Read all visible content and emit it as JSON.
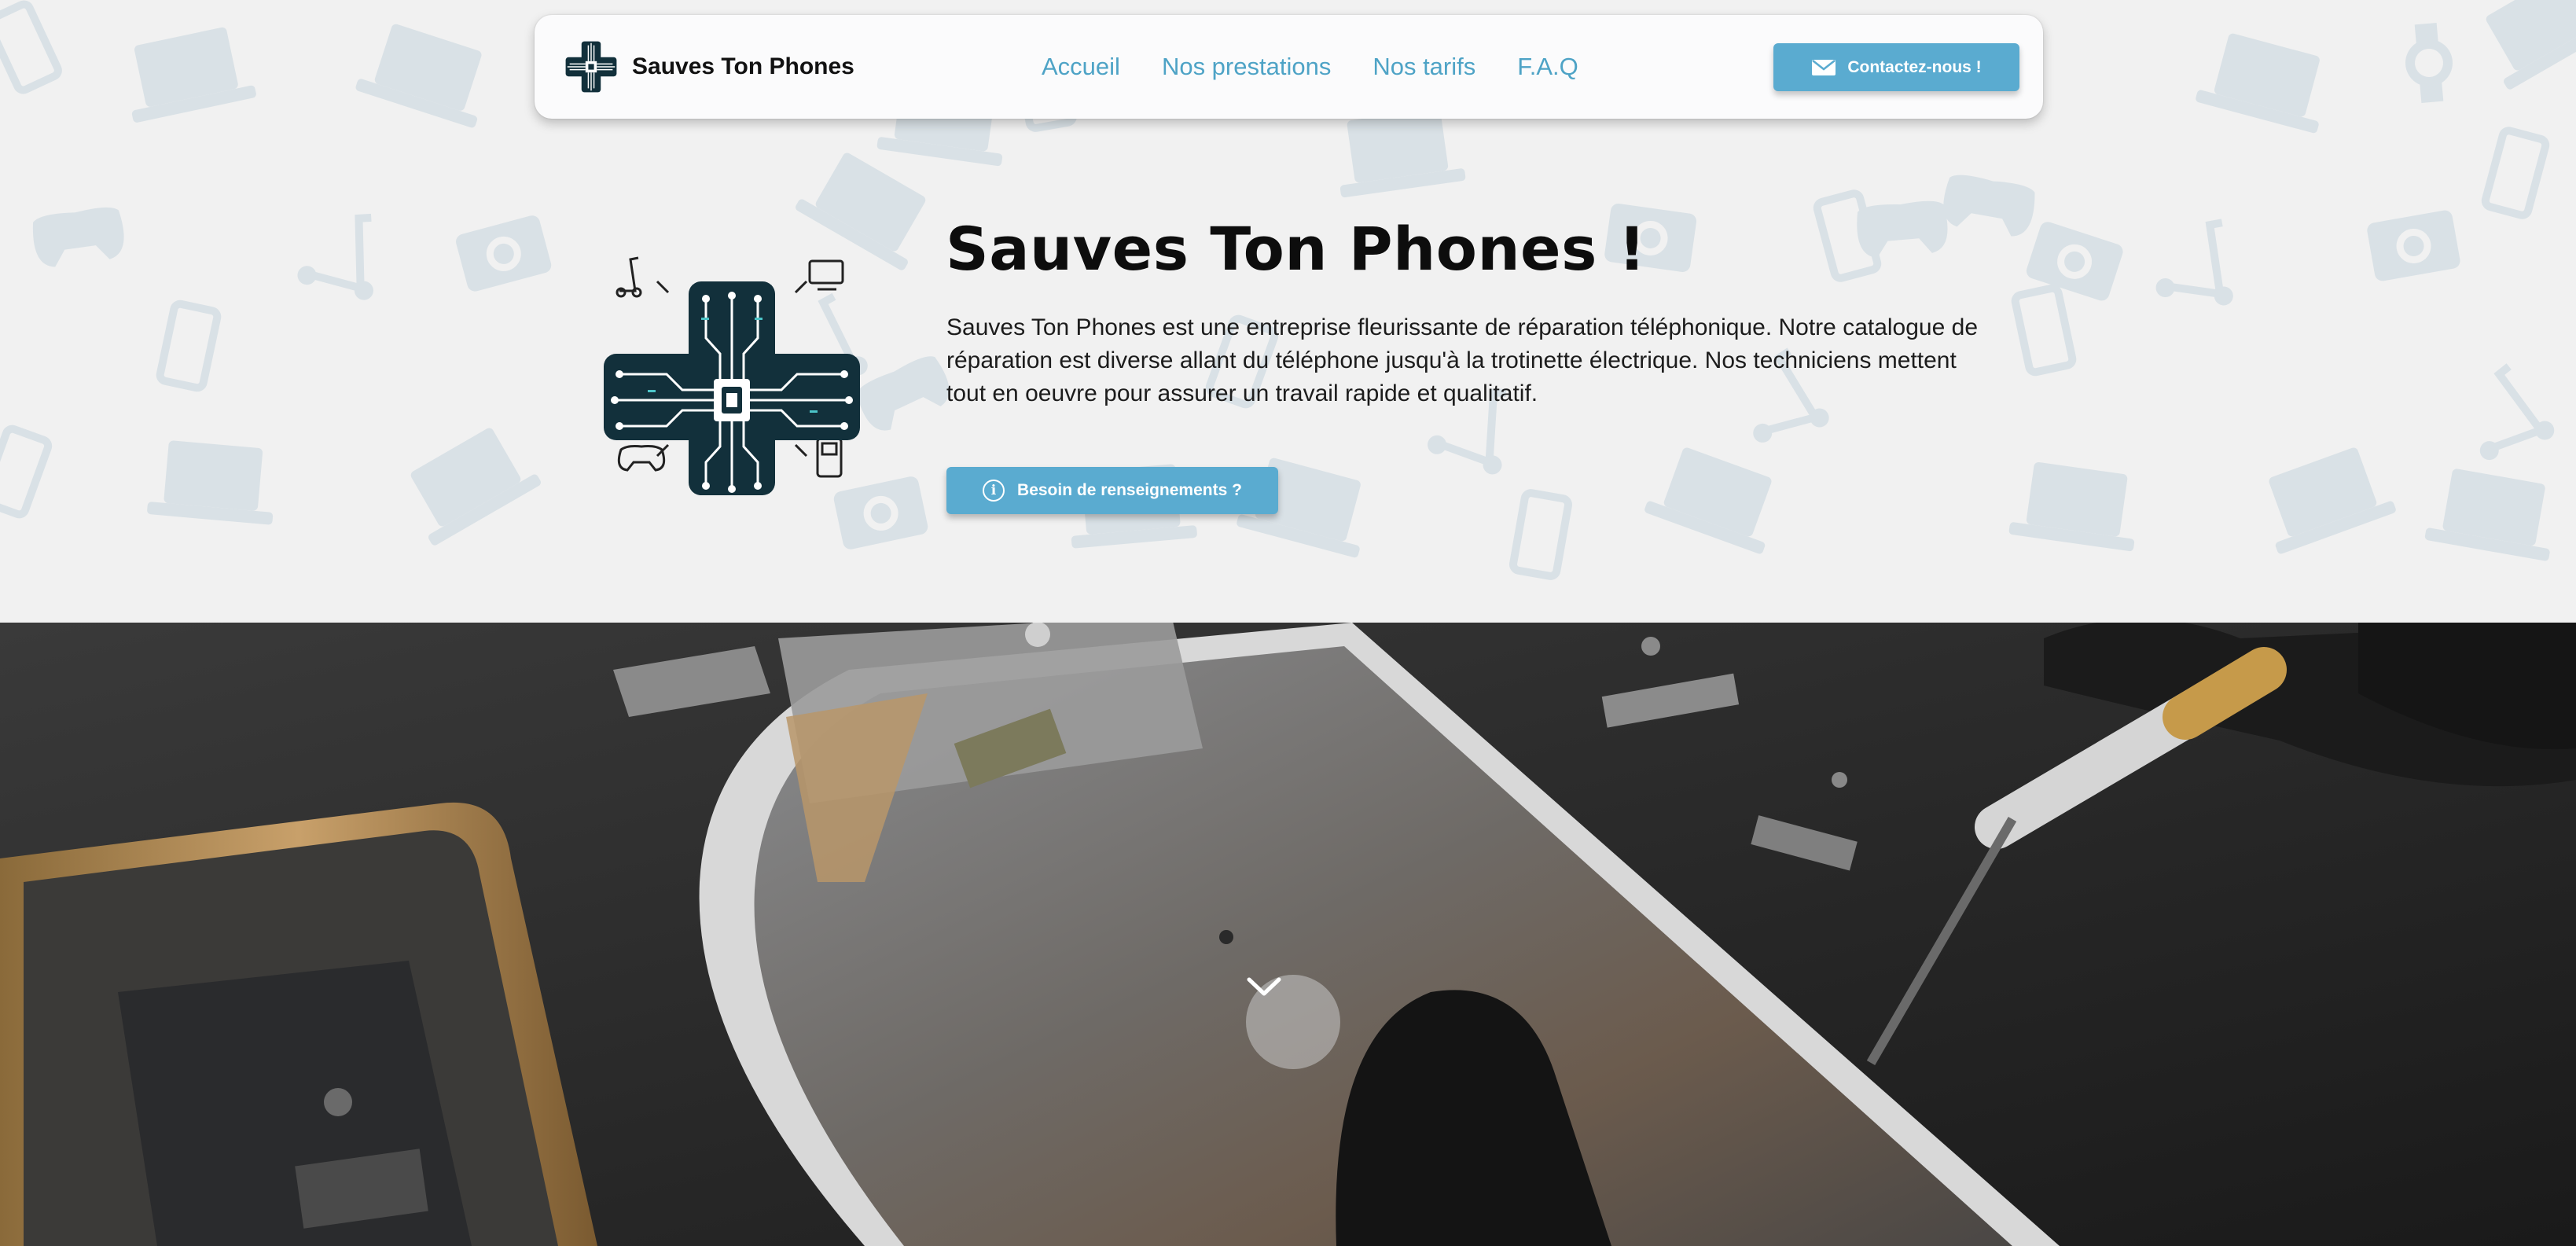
{
  "brand": {
    "name": "Sauves Ton Phones",
    "logo_icon": "circuit-cross-logo"
  },
  "nav": {
    "links": [
      "Accueil",
      "Nos prestations",
      "Nos tarifs",
      "F.A.Q"
    ],
    "contact_label": "Contactez-nous !",
    "contact_icon": "envelope-icon"
  },
  "hero": {
    "title": "Sauves Ton Phones !",
    "description": "Sauves Ton Phones est une entreprise fleurissante de réparation téléphonique. Notre catalogue de réparation est diverse allant du téléphone jusqu'à la trotinette électrique. Nos techniciens mettent tout en oeuvre pour assurer un travail rapide et qualitatif.",
    "info_button_label": "Besoin de renseignements ?",
    "info_icon": "info-icon"
  },
  "photo": {
    "scroll_icon": "chevron-down-icon"
  },
  "colors": {
    "accent": "#5aabd0",
    "nav_link": "#4ea3c6",
    "pattern_icons": "#d9e1e6",
    "logo_dark": "#12303b"
  }
}
